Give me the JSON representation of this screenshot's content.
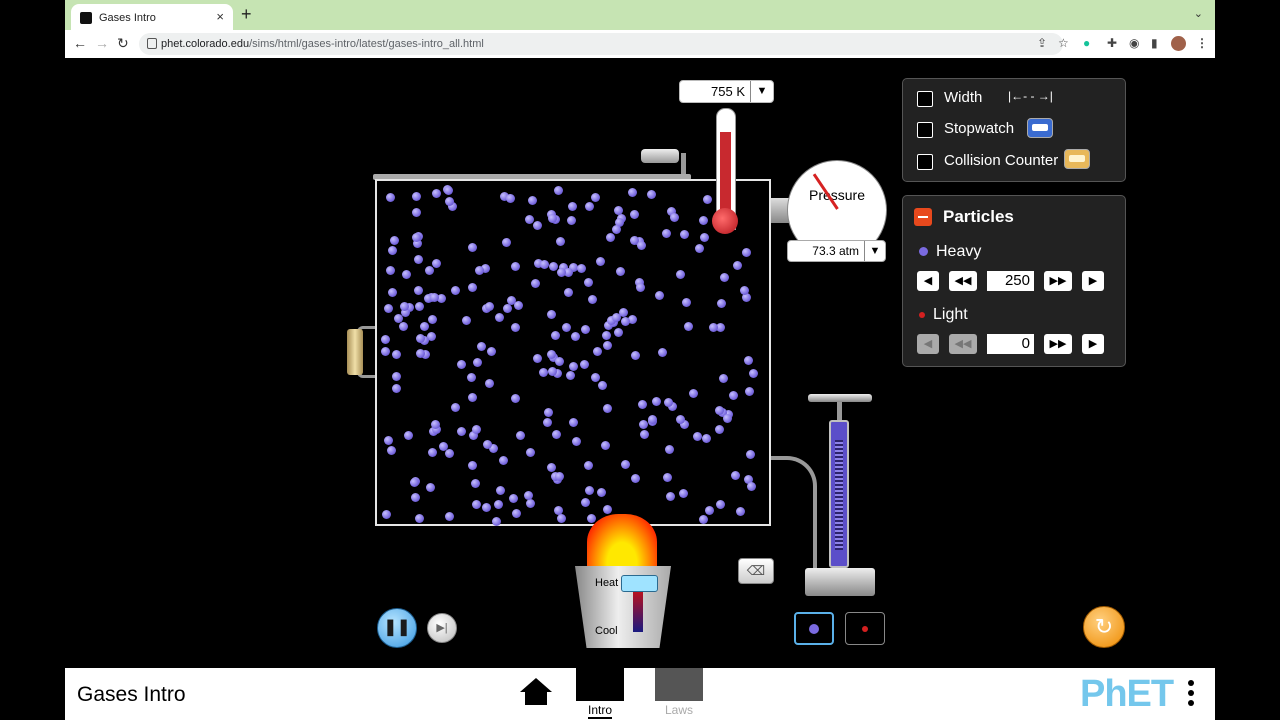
{
  "browser": {
    "tab_title": "Gases Intro",
    "tab_close": "×",
    "new_tab": "+",
    "tab_menu": "⌄",
    "url_host": "phet.colorado.edu",
    "url_path": "/sims/html/gases-intro/latest/gases-intro_all.html",
    "nav_back": "←",
    "nav_forward": "→",
    "nav_reload": "↻",
    "toolbar_icons": [
      "share-icon",
      "star-icon",
      "grammarly-icon",
      "extension-icon",
      "media-icon",
      "sidebar-icon",
      "avatar",
      "menu-icon"
    ]
  },
  "sim": {
    "temperature": {
      "value": "755 K",
      "dropdown": "▼"
    },
    "pressure": {
      "label": "Pressure",
      "value": "73.3 atm",
      "dropdown": "▼"
    },
    "heater": {
      "heat_label": "Heat",
      "cool_label": "Cool"
    },
    "eraser_icon": "eraser-icon",
    "play_pause_icon": "❚❚",
    "step_icon": "▶|",
    "reset_icon": "↻"
  },
  "tools_panel": {
    "width_label": "Width",
    "width_icon": "|←- - →|",
    "stopwatch_label": "Stopwatch",
    "collision_label": "Collision Counter"
  },
  "particles_panel": {
    "title": "Particles",
    "heavy": {
      "label": "Heavy",
      "value": "250",
      "color": "#7a6ae0"
    },
    "light": {
      "label": "Light",
      "value": "0",
      "color": "#d42020"
    },
    "btn_dec1": "◀",
    "btn_dec2": "◀◀",
    "btn_inc2": "▶▶",
    "btn_inc1": "▶"
  },
  "navbar": {
    "sim_title": "Gases Intro",
    "screens": [
      {
        "label": "Intro"
      },
      {
        "label": "Laws"
      }
    ],
    "logo": "PhET"
  },
  "colors": {
    "accent_blue": "#5ab0e8",
    "reset_orange": "#ee8a00",
    "panel_bg": "#222222",
    "minus_red": "#e8491d"
  }
}
